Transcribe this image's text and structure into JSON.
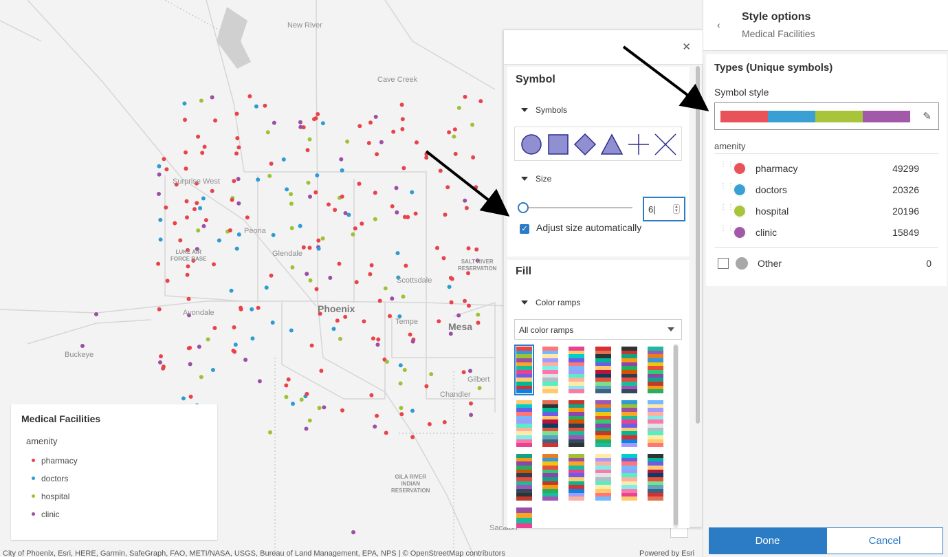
{
  "map": {
    "places": [
      {
        "name": "New River",
        "cls": ""
      },
      {
        "name": "Cave Creek",
        "cls": ""
      },
      {
        "name": "Surprise West",
        "cls": ""
      },
      {
        "name": "Peoria",
        "cls": ""
      },
      {
        "name": "Glendale",
        "cls": ""
      },
      {
        "name": "Scottsdale",
        "cls": ""
      },
      {
        "name": "Phoenix",
        "cls": "big"
      },
      {
        "name": "Tempe",
        "cls": ""
      },
      {
        "name": "Mesa",
        "cls": "big"
      },
      {
        "name": "Avondale",
        "cls": ""
      },
      {
        "name": "Buckeye",
        "cls": ""
      },
      {
        "name": "Gilbert",
        "cls": ""
      },
      {
        "name": "Chandler",
        "cls": ""
      },
      {
        "name": "Sacaton",
        "cls": ""
      }
    ],
    "areas": [
      {
        "name": "LUKE AIR\nFORCE BASE"
      },
      {
        "name": "SALT RIVER\nRESERVATION"
      },
      {
        "name": "GILA RIVER\nINDIAN\nRESERVATION"
      }
    ],
    "attribution": "City of Phoenix, Esri, HERE, Garmin, SafeGraph, FAO, METI/NASA, USGS, Bureau of Land Management, EPA, NPS | © OpenStreetMap contributors",
    "powered_by": "Powered by Esri",
    "category_colors": {
      "pharmacy": "#e8434a",
      "doctors": "#2e9bd1",
      "hospital": "#9dc234",
      "clinic": "#9b4ea3"
    }
  },
  "legend": {
    "title": "Medical Facilities",
    "field": "amenity",
    "items": [
      {
        "label": "pharmacy",
        "color": "#e8434a"
      },
      {
        "label": "doctors",
        "color": "#2e9bd1"
      },
      {
        "label": "hospital",
        "color": "#9dc234"
      },
      {
        "label": "clinic",
        "color": "#9b4ea3"
      }
    ]
  },
  "symbol_panel": {
    "close_icon": "close-icon",
    "symbol_title": "Symbol",
    "symbols_label": "Symbols",
    "shapes": [
      "circle",
      "square",
      "diamond",
      "triangle",
      "cross",
      "x"
    ],
    "size_label": "Size",
    "size_value": "6",
    "size_fraction": 0.0,
    "adjust_label": "Adjust size automatically",
    "adjust_checked": true,
    "fill_title": "Fill",
    "color_ramps_label": "Color ramps",
    "ramp_filter": "All color ramps"
  },
  "style_panel": {
    "title": "Style options",
    "subtitle": "Medical Facilities",
    "section_title": "Types (Unique symbols)",
    "symbol_style_label": "Symbol style",
    "field_label": "amenity",
    "categories": [
      {
        "name": "pharmacy",
        "count": "49299",
        "color": "#e8535a"
      },
      {
        "name": "doctors",
        "count": "20326",
        "color": "#3a9fd3"
      },
      {
        "name": "hospital",
        "count": "20196",
        "color": "#a7c43a"
      },
      {
        "name": "clinic",
        "count": "15849",
        "color": "#a259a9"
      }
    ],
    "other": {
      "name": "Other",
      "count": "0",
      "color": "#a8a8a8"
    },
    "done_label": "Done",
    "cancel_label": "Cancel"
  }
}
